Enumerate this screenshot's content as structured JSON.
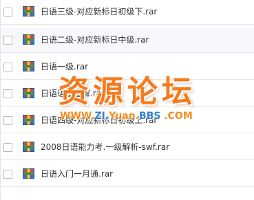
{
  "files": [
    {
      "name": "日语三级-对应新标日初级下.rar"
    },
    {
      "name": "日语二级-对应新标日中级.rar"
    },
    {
      "name": "日语一级.rar"
    },
    {
      "name": "日语语法图解.rar"
    },
    {
      "name": "日语四级-对应新标日初级上.rar"
    },
    {
      "name": "2008日语能力考.一级解析-swf.rar"
    },
    {
      "name": "日语入门一月通.rar"
    }
  ],
  "watermark": {
    "title": "资源论坛",
    "url_prefix": "WWW.",
    "url_zi": "ZI.",
    "url_yuan": "Yuan.",
    "url_bbs": "BBS",
    "url_suffix": " .COM"
  },
  "colors": {
    "watermark_orange": "#f47b1e",
    "watermark_blue": "#2f7fd0"
  }
}
